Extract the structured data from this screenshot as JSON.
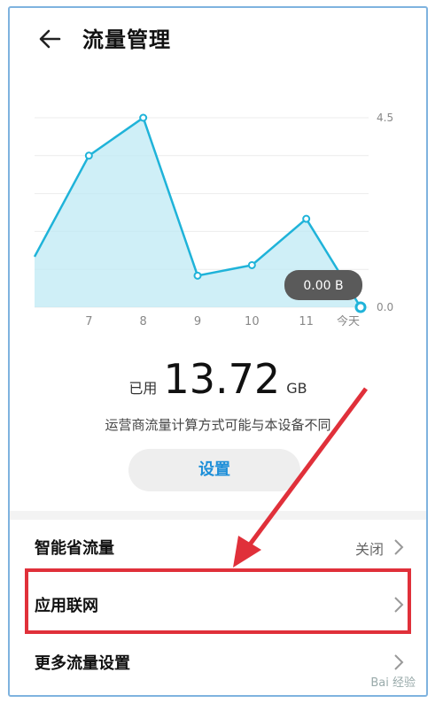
{
  "header": {
    "title": "流量管理",
    "back_icon": "back-arrow-icon"
  },
  "chart_data": {
    "type": "area",
    "categories": [
      "",
      "7",
      "8",
      "9",
      "10",
      "11",
      "今天"
    ],
    "values": [
      1.2,
      3.6,
      4.5,
      0.75,
      1.0,
      2.1,
      0.0
    ],
    "ylim": [
      0,
      4.5
    ],
    "y_ticks": [
      "4.5",
      "0.0"
    ],
    "tooltip": "0.00 B",
    "colors": {
      "line": "#1fb3d9",
      "fill": "#bfe9f4"
    }
  },
  "usage": {
    "prefix": "已用",
    "value": "13.72",
    "unit": "GB"
  },
  "note": "运营商流量计算方式可能与本设备不同",
  "settings_button": "设置",
  "rows": [
    {
      "label": "智能省流量",
      "value": "关闭"
    },
    {
      "label": "应用联网",
      "value": ""
    },
    {
      "label": "更多流量设置",
      "value": ""
    }
  ],
  "watermark": "Bai 经验",
  "colors": {
    "accent": "#1e8fd8",
    "highlight": "#e0303a"
  }
}
